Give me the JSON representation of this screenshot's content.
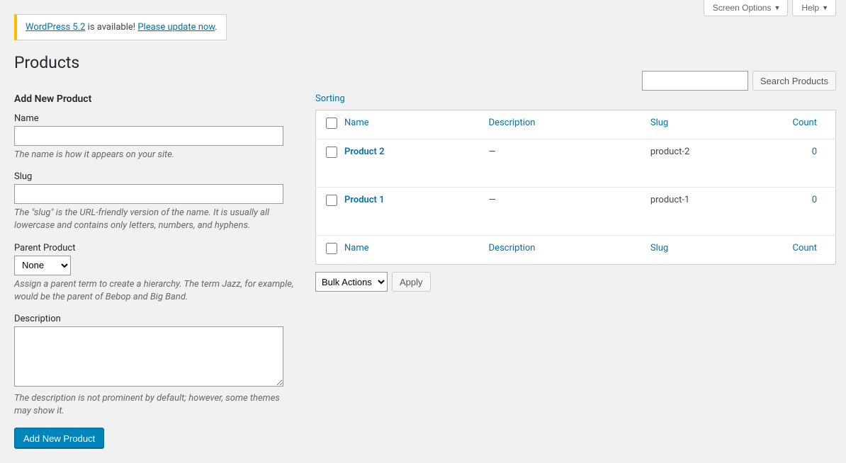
{
  "topTabs": {
    "screenOptions": "Screen Options",
    "help": "Help"
  },
  "notice": {
    "prefixLink": "WordPress 5.2",
    "middle": " is available! ",
    "actionLink": "Please update now",
    "suffix": "."
  },
  "pageTitle": "Products",
  "search": {
    "placeholder": "",
    "button": "Search Products"
  },
  "form": {
    "heading": "Add New Product",
    "name": {
      "label": "Name",
      "desc": "The name is how it appears on your site."
    },
    "slug": {
      "label": "Slug",
      "desc": "The \"slug\" is the URL-friendly version of the name. It is usually all lowercase and contains only letters, numbers, and hyphens."
    },
    "parent": {
      "label": "Parent Product",
      "selected": "None",
      "desc": "Assign a parent term to create a hierarchy. The term Jazz, for example, would be the parent of Bebop and Big Band."
    },
    "description": {
      "label": "Description",
      "desc": "The description is not prominent by default; however, some themes may show it."
    },
    "submit": "Add New Product"
  },
  "sortingLink": "Sorting",
  "columns": {
    "name": "Name",
    "description": "Description",
    "slug": "Slug",
    "count": "Count"
  },
  "rows": [
    {
      "name": "Product 2",
      "description": "—",
      "slug": "product-2",
      "count": "0"
    },
    {
      "name": "Product 1",
      "description": "—",
      "slug": "product-1",
      "count": "0"
    }
  ],
  "bulk": {
    "selected": "Bulk Actions",
    "apply": "Apply"
  }
}
